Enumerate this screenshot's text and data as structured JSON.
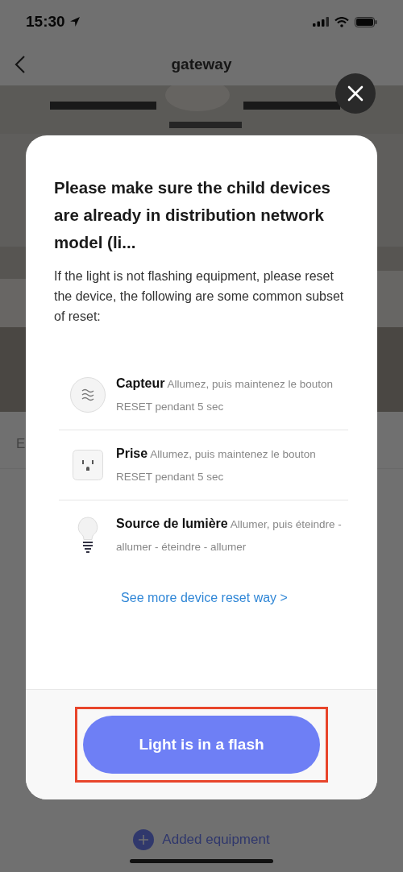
{
  "status_bar": {
    "time": "15:30"
  },
  "nav": {
    "title": "gateway"
  },
  "background_fragments": [
    {
      "text": "E",
      "kind": "row"
    }
  ],
  "modal": {
    "title": "Please make sure the child devices are already in distribution network model (li...",
    "description": "If the light is not flashing equipment, please reset the device, the following are some common subset of reset:",
    "devices": [
      {
        "kind": "sensor",
        "name": "Capteur",
        "instruction": "Allumez, puis maintenez le bouton RESET pendant 5 sec"
      },
      {
        "kind": "plug",
        "name": "Prise",
        "instruction": "Allumez, puis maintenez le bouton RESET pendant 5 sec"
      },
      {
        "kind": "bulb",
        "name": "Source de lumière",
        "instruction": "Allumer, puis éteindre - allumer - éteindre - allumer"
      }
    ],
    "link": "See more device reset way >",
    "button": {
      "label": "Light is in a flash",
      "highlighted": true
    }
  },
  "add_button": {
    "label": "Added equipment"
  }
}
